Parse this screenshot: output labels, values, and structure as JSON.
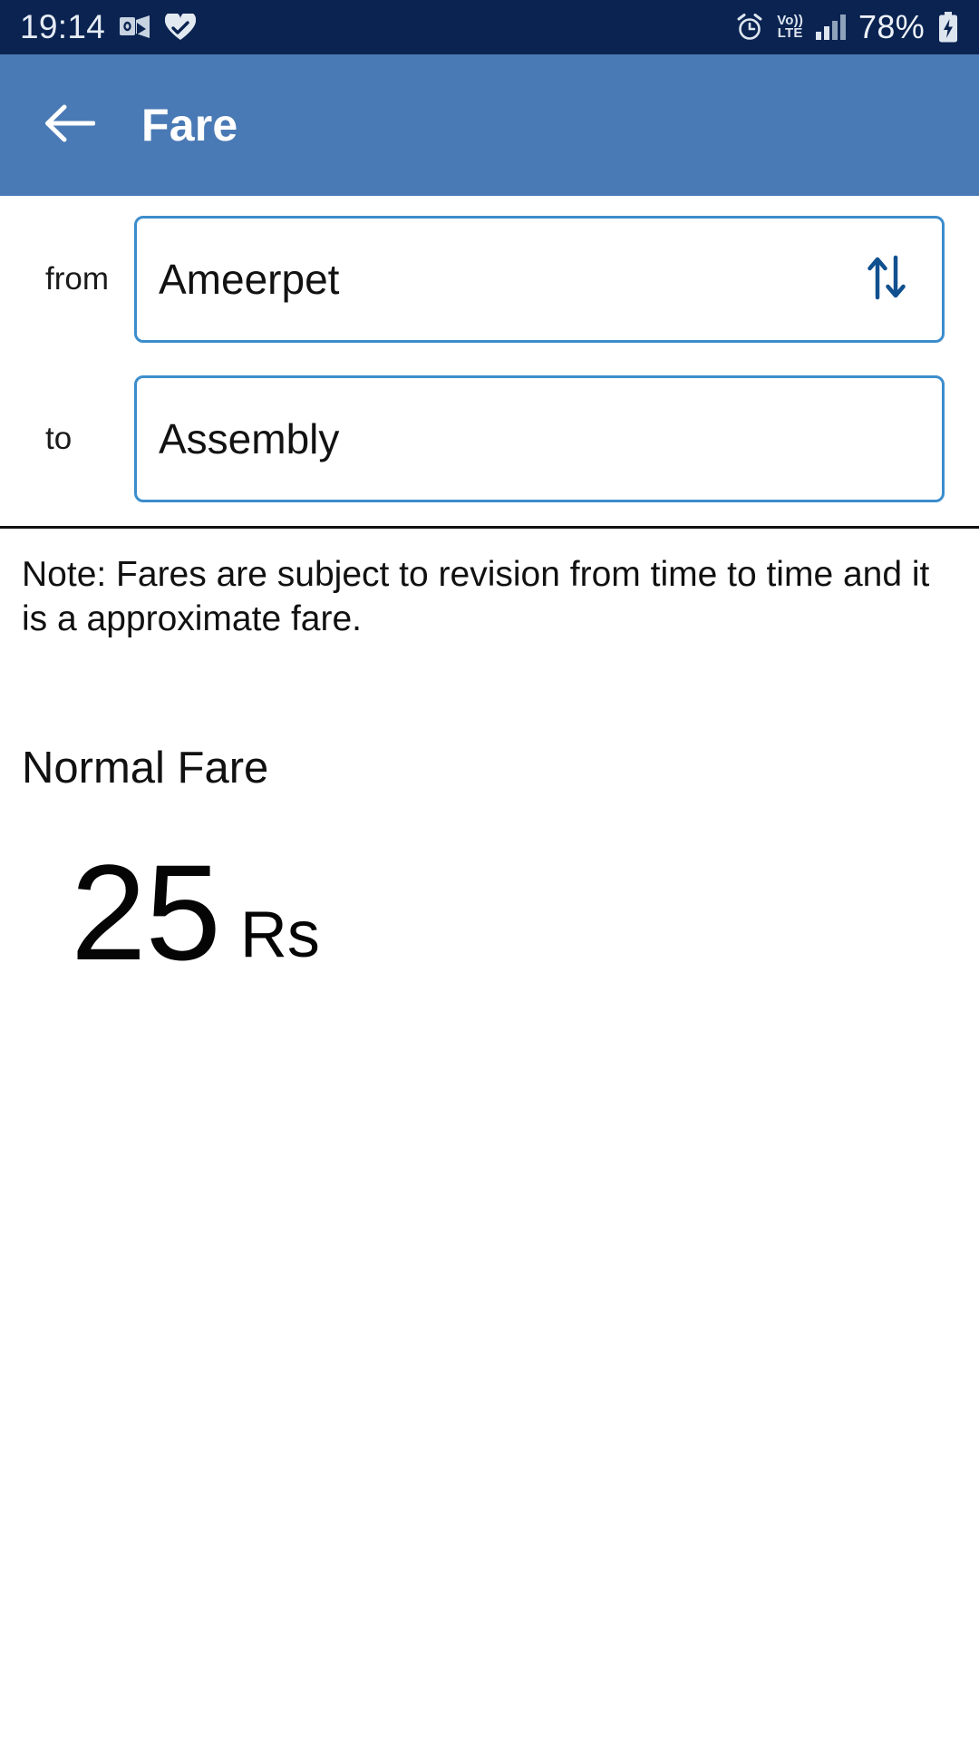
{
  "status_bar": {
    "time": "19:14",
    "battery_percent": "78%",
    "network_label_top": "Vo))",
    "network_label_bottom": "LTE",
    "icons": [
      "outlook-icon",
      "heart-health-icon",
      "alarm-icon",
      "volte-icon",
      "signal-bars-icon",
      "battery-charging-icon"
    ],
    "background_color": "#0a2351"
  },
  "app_bar": {
    "title": "Fare",
    "back_label": "back-arrow",
    "background_color": "#4a7ab5"
  },
  "form": {
    "from": {
      "label": "from",
      "value": "Ameerpet",
      "placeholder": "from"
    },
    "to": {
      "label": "to",
      "value": "Assembly",
      "placeholder": "to"
    },
    "swap_label": "swap",
    "border_color": "#3c8dcc"
  },
  "note": {
    "text": "Note: Fares are subject to revision from time to time and it is a approximate fare."
  },
  "fare": {
    "heading": "Normal Fare",
    "value": "25",
    "unit": "Rs"
  }
}
